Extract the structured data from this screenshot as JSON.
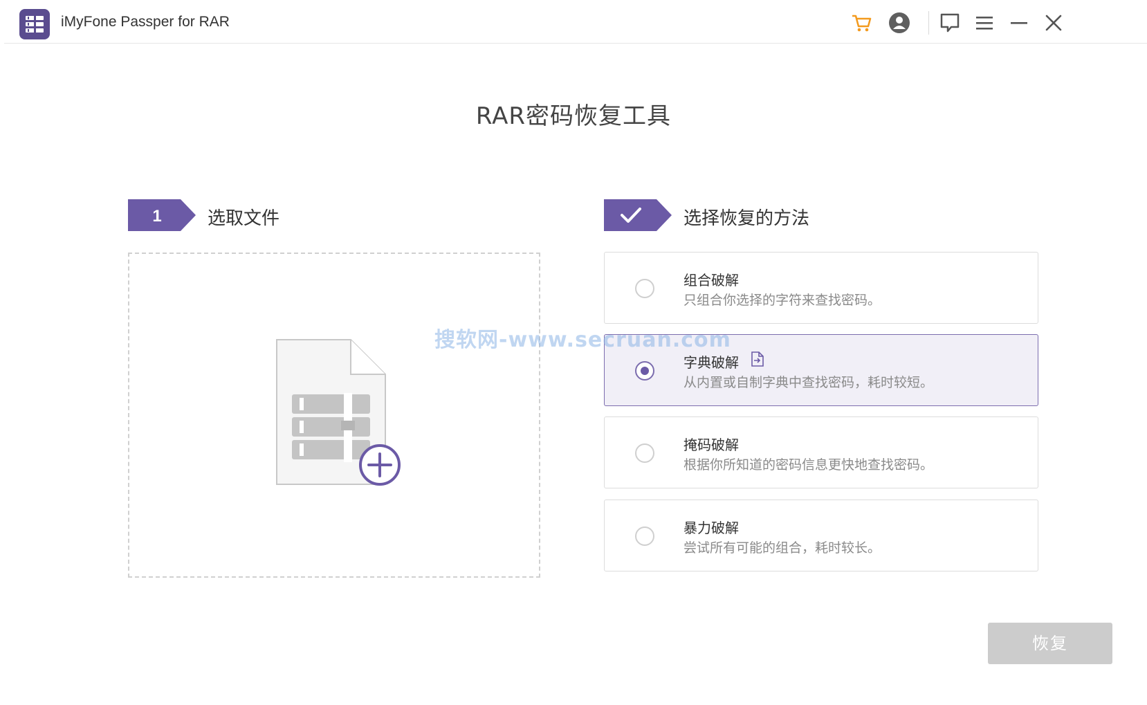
{
  "window": {
    "title": "iMyFone Passper for RAR",
    "icons": [
      "cart-icon",
      "account-icon",
      "feedback-icon",
      "menu-icon",
      "minimize-icon",
      "close-icon"
    ],
    "accent_color": "#6b5aa6"
  },
  "main": {
    "title": "RAR密码恢复工具"
  },
  "step1": {
    "number": "1",
    "label": "选取文件"
  },
  "step2": {
    "label": "选择恢复的方法"
  },
  "options": [
    {
      "title": "组合破解",
      "desc": "只组合你选择的字符来查找密码。",
      "selected": false
    },
    {
      "title": "字典破解",
      "desc": "从内置或自制字典中查找密码，耗时较短。",
      "selected": true
    },
    {
      "title": "掩码破解",
      "desc": "根据你所知道的密码信息更快地查找密码。",
      "selected": false
    },
    {
      "title": "暴力破解",
      "desc": "尝试所有可能的组合，耗时较长。",
      "selected": false
    }
  ],
  "watermark": "搜软网-www.secruan.com",
  "recover_button": "恢复"
}
